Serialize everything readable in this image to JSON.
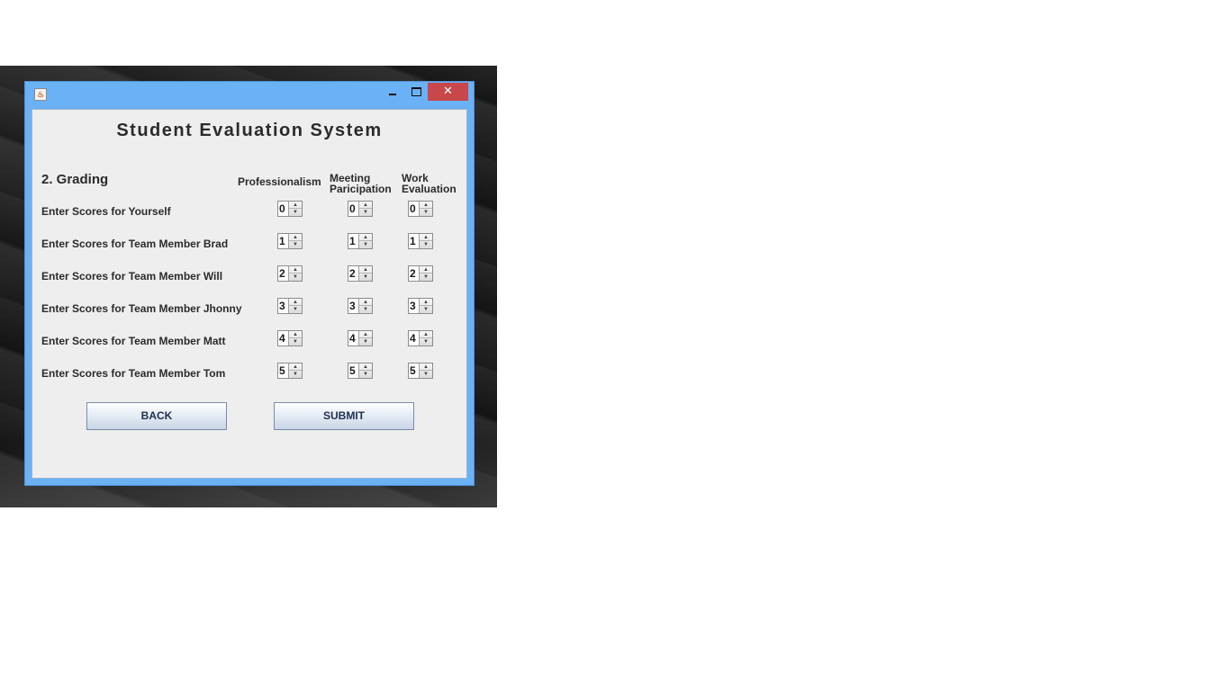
{
  "window": {
    "app_icon_glyph": "♨",
    "close_glyph": "✕"
  },
  "main": {
    "title": "Student Evaluation System",
    "section_heading": "2. Grading",
    "columns": {
      "professionalism": "Professionalism",
      "meeting_line1": "Meeting",
      "meeting_line2": "Paricipation",
      "work_line1": "Work",
      "work_line2": "Evaluation"
    },
    "rows": [
      {
        "label": "Enter Scores for Yourself",
        "professionalism": "0",
        "meeting": "0",
        "work": "0"
      },
      {
        "label": "Enter Scores for Team Member Brad",
        "professionalism": "1",
        "meeting": "1",
        "work": "1"
      },
      {
        "label": "Enter Scores for Team Member Will",
        "professionalism": "2",
        "meeting": "2",
        "work": "2"
      },
      {
        "label": "Enter Scores for Team Member Jhonny",
        "professionalism": "3",
        "meeting": "3",
        "work": "3"
      },
      {
        "label": "Enter Scores for Team Member Matt",
        "professionalism": "4",
        "meeting": "4",
        "work": "4"
      },
      {
        "label": "Enter Scores for Team Member Tom",
        "professionalism": "5",
        "meeting": "5",
        "work": "5"
      }
    ],
    "buttons": {
      "back": "BACK",
      "submit": "SUBMIT"
    }
  },
  "colors": {
    "title_bar": "#6ab1f5",
    "close_button": "#c7474a",
    "panel": "#eeeeee"
  }
}
